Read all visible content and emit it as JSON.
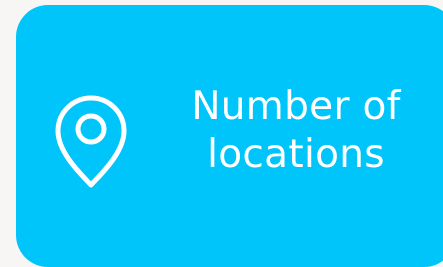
{
  "card": {
    "background": "#00c5fb",
    "icon": "location-pin-icon",
    "label_line1": "Number of",
    "label_line2": "locations",
    "text_color": "#ffffff"
  }
}
